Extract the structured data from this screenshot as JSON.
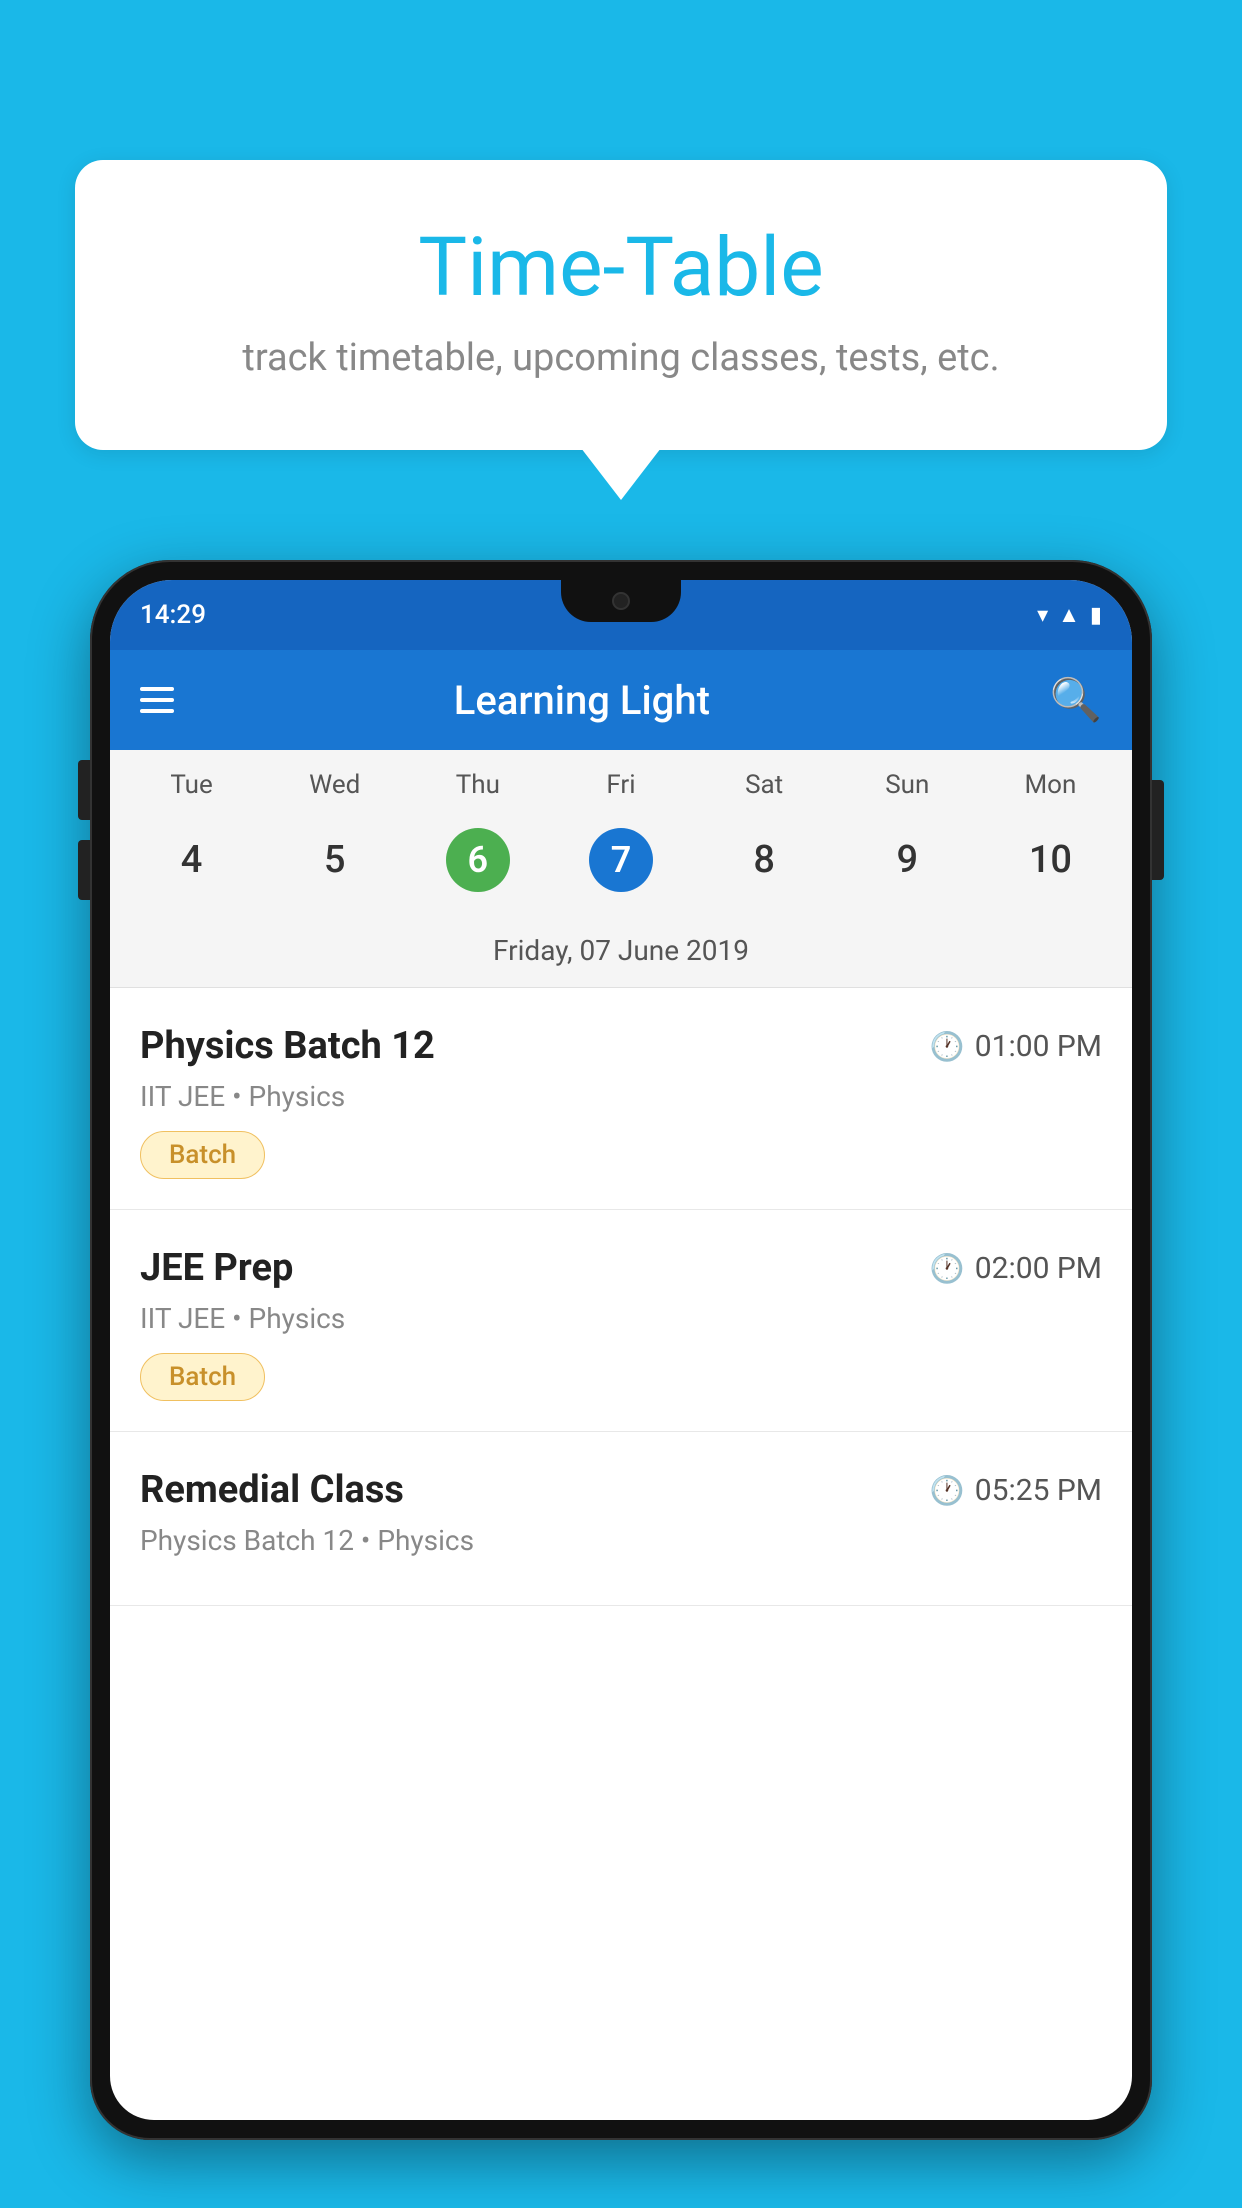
{
  "background": {
    "color": "#1ab8e8"
  },
  "speechBubble": {
    "title": "Time-Table",
    "subtitle": "track timetable, upcoming classes, tests, etc."
  },
  "phone": {
    "statusBar": {
      "time": "14:29"
    },
    "appHeader": {
      "title": "Learning Light"
    },
    "calendar": {
      "dayLabels": [
        "Tue",
        "Wed",
        "Thu",
        "Fri",
        "Sat",
        "Sun",
        "Mon"
      ],
      "dayNumbers": [
        {
          "num": "4",
          "style": "normal"
        },
        {
          "num": "5",
          "style": "normal"
        },
        {
          "num": "6",
          "style": "green"
        },
        {
          "num": "7",
          "style": "blue"
        },
        {
          "num": "8",
          "style": "normal"
        },
        {
          "num": "9",
          "style": "normal"
        },
        {
          "num": "10",
          "style": "normal"
        }
      ],
      "selectedDate": "Friday, 07 June 2019"
    },
    "scheduleItems": [
      {
        "title": "Physics Batch 12",
        "time": "01:00 PM",
        "sub": "IIT JEE • Physics",
        "tag": "Batch"
      },
      {
        "title": "JEE Prep",
        "time": "02:00 PM",
        "sub": "IIT JEE • Physics",
        "tag": "Batch"
      },
      {
        "title": "Remedial Class",
        "time": "05:25 PM",
        "sub": "Physics Batch 12 • Physics",
        "tag": ""
      }
    ]
  }
}
